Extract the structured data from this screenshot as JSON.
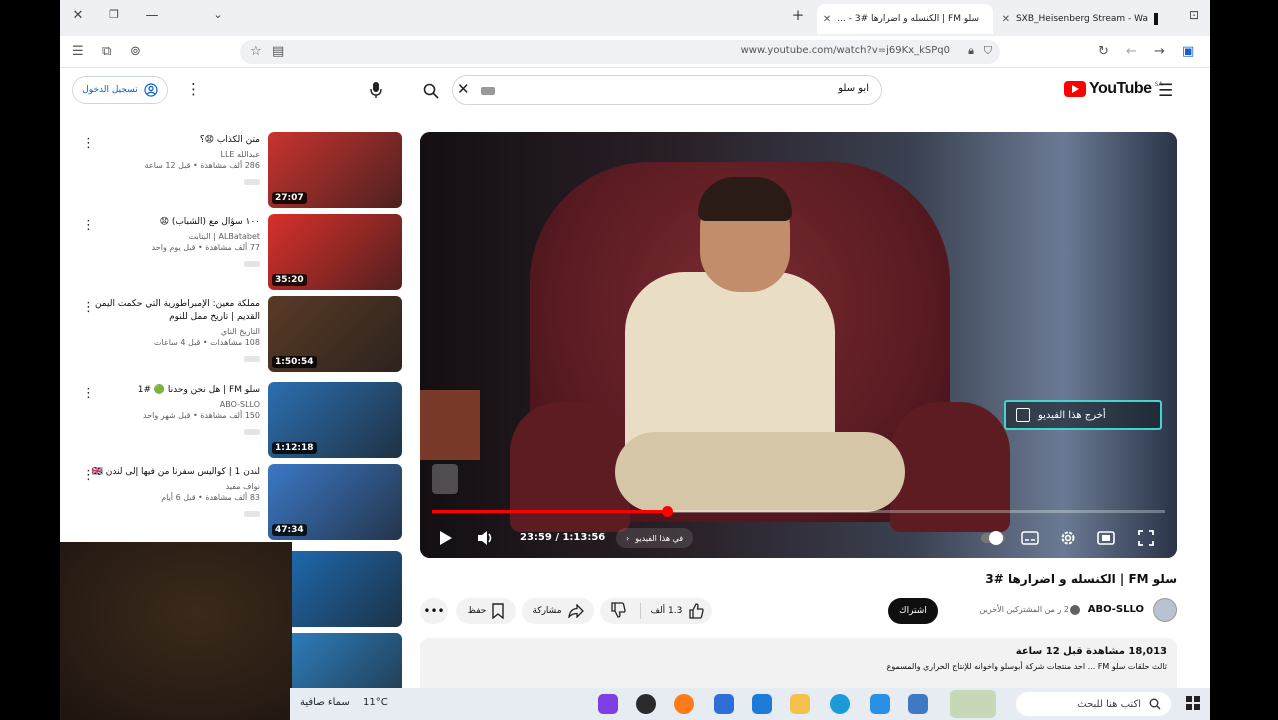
{
  "browser": {
    "tabs": [
      {
        "title": "سلو FM | الكنسله و اضرارها #3 - ...",
        "active": true
      },
      {
        "title": "SXB_Heisenberg Stream - Wa",
        "active": false
      }
    ],
    "url": "www.youtube.com/watch?v=j69Kx_kSPq0"
  },
  "youtube": {
    "logo_text": "YouTube",
    "logo_region": "SA",
    "search_query": "ابو سلو",
    "signin_label": "تسجيل الدخول"
  },
  "player": {
    "current_time": "23:59",
    "duration": "1:13:56",
    "time_display": "23:59 / 1:13:56",
    "progress_fraction": 0.32,
    "chapter_label": "في هذا الفيديو",
    "endscreen_card": "أخرج هذا الفيديو"
  },
  "video": {
    "title": "سلو FM | الكنسله و اضرارها #3",
    "channel": "ABO-SLLO",
    "subscribers": "2 ر من المشتركين الأخرين",
    "subscribe_label": "اشتراك",
    "likes": "1.3 ألف",
    "share_label": "مشاركة",
    "save_label": "حفظ",
    "views_time": "18,013 مشاهدة قبل 12 ساعة",
    "description": "ثالث حلقات سلو FM ... احد منتجات شركة أبوسلو واخوانه للإنتاج الحراري والمسموع"
  },
  "related": [
    {
      "title": "متن الكذاب 😧؟",
      "channel": "عبدالله LLE",
      "meta": "286 ألف مشاهدة • قبل 12 ساعة",
      "duration": "27:07",
      "thumb_color": "#c9332f"
    },
    {
      "title": "١٠٠ سؤال مع (الشباب) 😧",
      "channel": "ALBatabet | البتابت",
      "meta": "77 ألف مشاهدة • قبل يوم واحد",
      "duration": "35:20",
      "thumb_color": "#d9302b"
    },
    {
      "title": "مملكة معين: الإمبراطورية التي حكمت اليمن القديم | تاريخ ممل للنوم",
      "channel": "التاريخ الناي",
      "meta": "108 مشاهدات • قبل 4 ساعات",
      "duration": "1:50:54",
      "thumb_color": "#5a3a26"
    },
    {
      "title": "سلو FM | هل نحن وحدنا 🟢 #1",
      "channel": "ABO-SLLO",
      "meta": "150 ألف مشاهدة • قبل شهر واحد",
      "duration": "1:12:18",
      "thumb_color": "#2b6fb0"
    },
    {
      "title": "لندن 1 | كواليس سفرنا من فيها إلى لندن 🇬🇧",
      "channel": "نواف مفيد",
      "meta": "83 ألف مشاهدة • قبل 6 أيام",
      "duration": "47:34",
      "thumb_color": "#3b78c5"
    },
    {
      "title": "",
      "channel": "",
      "meta": "",
      "duration": "",
      "thumb_color": "#1f6fb8"
    },
    {
      "title": "",
      "channel": "",
      "meta": "",
      "duration": "",
      "thumb_color": "#2f85c9"
    }
  ],
  "taskbar": {
    "search_placeholder": "اكتب هنا للبحث",
    "weather_temp": "11°C",
    "weather_desc": "سماء صافية"
  },
  "colors": {
    "brand": "#ff0000",
    "link": "#065fd4",
    "card_border": "#44d4c8"
  }
}
